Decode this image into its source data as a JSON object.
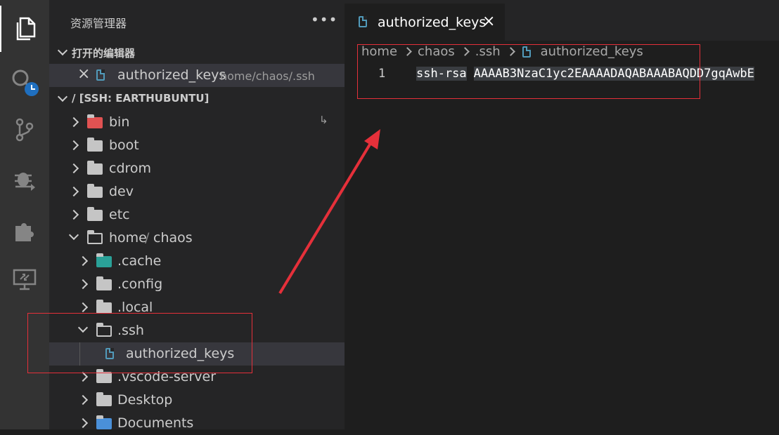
{
  "sidebar": {
    "title": "资源管理器",
    "more": "•••",
    "open_editors_title": "打开的编辑器",
    "open_editor": {
      "name": "authorized_keys",
      "path": "home/chaos/.ssh"
    },
    "remote_title": "/ [SSH: EARTHUBUNTU]",
    "tree": [
      {
        "label": "bin",
        "symlink": "↳"
      },
      {
        "label": "boot"
      },
      {
        "label": "cdrom"
      },
      {
        "label": "dev"
      },
      {
        "label": "etc"
      },
      {
        "label": "home",
        "label2": "chaos",
        "sep": "/"
      },
      {
        "label": ".cache"
      },
      {
        "label": ".config"
      },
      {
        "label": ".local"
      },
      {
        "label": ".ssh"
      },
      {
        "label": "authorized_keys"
      },
      {
        "label": ".vscode-server"
      },
      {
        "label": "Desktop"
      },
      {
        "label": "Documents"
      }
    ]
  },
  "editor": {
    "tab_label": "authorized_keys",
    "tab_close": "×",
    "breadcrumb": [
      "home",
      "chaos",
      ".ssh",
      "authorized_keys"
    ],
    "line_number": "1",
    "code_keyword": "ssh-rsa",
    "code_value": "AAAAB3NzaC1yc2EAAAADAQABAAABAQDD7gqAwbE"
  },
  "colors": {
    "annotation": "#e5303a",
    "file_icon": "#519aba",
    "bin_folder": "#e05252",
    "cache_folder": "#2aa198",
    "documents_folder": "#4a90d9"
  }
}
